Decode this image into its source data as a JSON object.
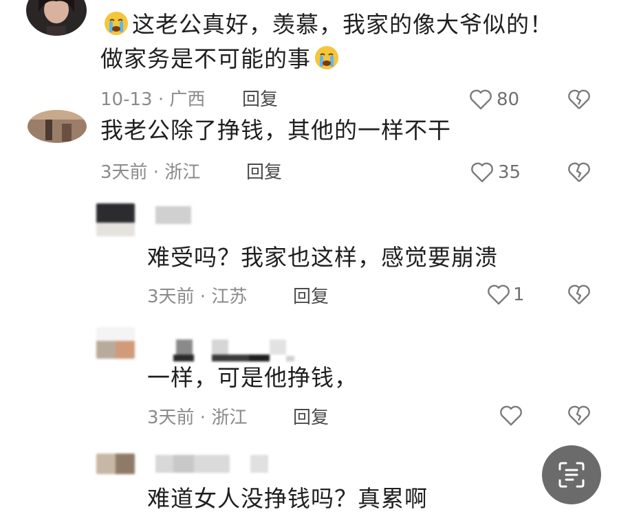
{
  "comments": [
    {
      "text_part1": "这老公真好，羡慕，我家的像大爷似的！",
      "text_part2": "做家务是不可能的事",
      "emoji": "crying-face",
      "meta": "10-13 · 广西",
      "reply": "回复",
      "likes": "80"
    },
    {
      "text": "我老公除了挣钱，其他的一样不干",
      "meta": "3天前 · 浙江",
      "reply": "回复",
      "likes": "35"
    }
  ],
  "replies": [
    {
      "text": "难受吗？我家也这样，感觉要崩溃",
      "meta": "3天前 · 江苏",
      "reply": "回复",
      "likes": "1"
    },
    {
      "text": "一样，可是他挣钱，",
      "meta": "3天前 · 浙江",
      "reply": "回复",
      "likes": ""
    },
    {
      "text": "难道女人没挣钱吗？真累啊"
    }
  ],
  "icons": {
    "like": "heart-outline-icon",
    "dislike": "broken-heart-icon",
    "scan": "scan-text-icon"
  },
  "colors": {
    "text": "#1f1f1f",
    "meta": "#8a8a8a",
    "icon": "#7a7a7a",
    "floating_button": "#6b6b6b"
  }
}
